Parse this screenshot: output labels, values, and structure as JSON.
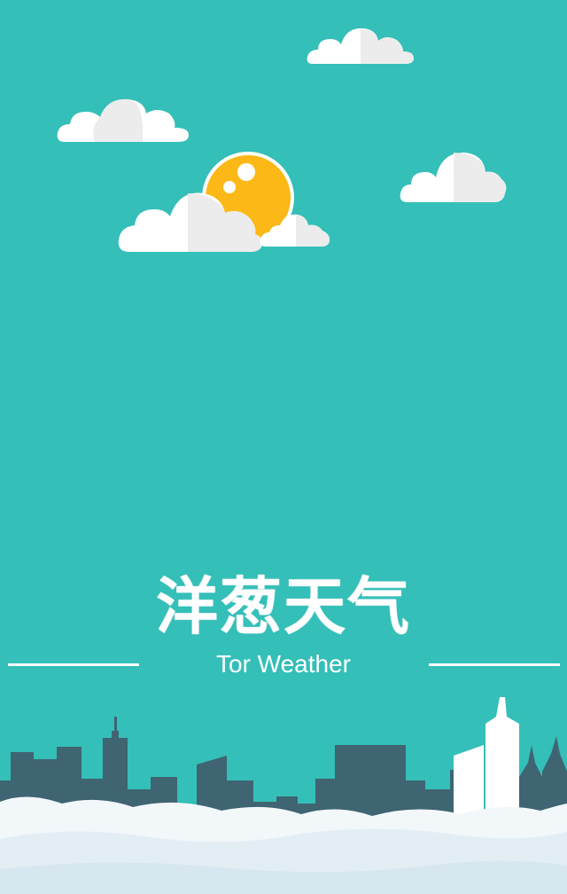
{
  "app": {
    "title": "洋葱天气",
    "subtitle": "Tor Weather"
  },
  "colors": {
    "background": "#34bfb8",
    "sun": "#fbb816",
    "cloud": "#ffffff",
    "cloud_shade": "#ececec",
    "building": "#3f6472",
    "building_light": "#ffffff",
    "ground_cloud": "#f2f7fa"
  },
  "icons": {
    "sun": "sun-icon",
    "cloud": "cloud-icon",
    "skyline": "city-skyline-illustration"
  }
}
